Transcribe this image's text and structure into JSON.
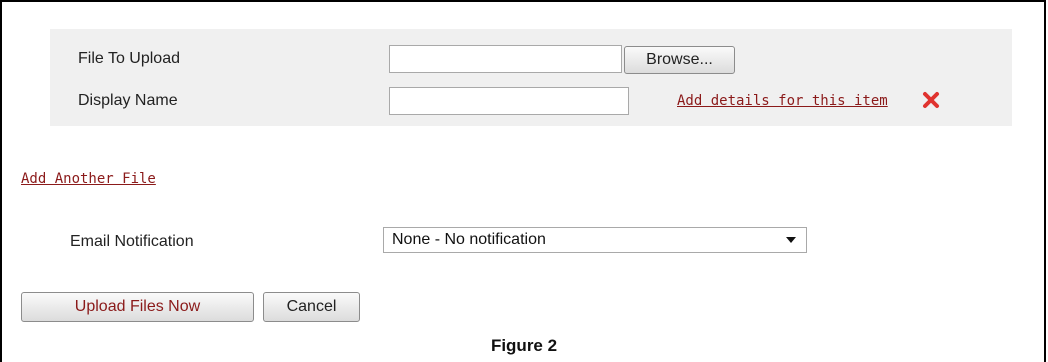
{
  "upload_panel": {
    "file_label": "File To Upload",
    "file_value": "",
    "browse_label": "Browse...",
    "display_name_label": "Display Name",
    "display_name_value": "",
    "add_details_link": "Add details for this item",
    "remove_icon": "close-x-icon",
    "remove_color": "#e0332f"
  },
  "add_another_link": "Add Another File",
  "email": {
    "label": "Email Notification",
    "selected": "None - No notification"
  },
  "buttons": {
    "upload": "Upload Files Now",
    "cancel": "Cancel"
  },
  "caption": "Figure 2",
  "colors": {
    "panel_bg": "#f0f0f0",
    "link": "#8b1a1a"
  }
}
